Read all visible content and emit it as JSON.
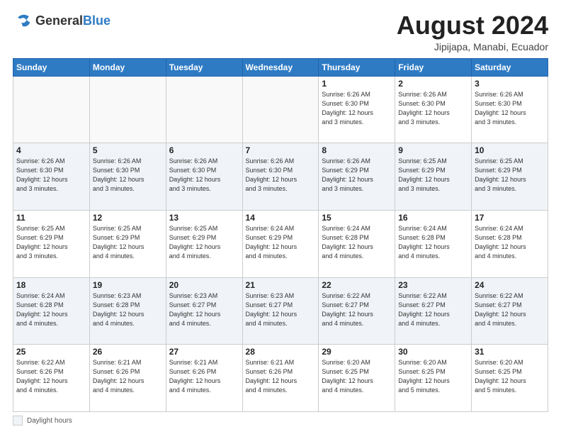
{
  "header": {
    "logo_general": "General",
    "logo_blue": "Blue",
    "month_year": "August 2024",
    "location": "Jipijapa, Manabi, Ecuador"
  },
  "days_of_week": [
    "Sunday",
    "Monday",
    "Tuesday",
    "Wednesday",
    "Thursday",
    "Friday",
    "Saturday"
  ],
  "weeks": [
    [
      {
        "day": "",
        "info": ""
      },
      {
        "day": "",
        "info": ""
      },
      {
        "day": "",
        "info": ""
      },
      {
        "day": "",
        "info": ""
      },
      {
        "day": "1",
        "info": "Sunrise: 6:26 AM\nSunset: 6:30 PM\nDaylight: 12 hours\nand 3 minutes."
      },
      {
        "day": "2",
        "info": "Sunrise: 6:26 AM\nSunset: 6:30 PM\nDaylight: 12 hours\nand 3 minutes."
      },
      {
        "day": "3",
        "info": "Sunrise: 6:26 AM\nSunset: 6:30 PM\nDaylight: 12 hours\nand 3 minutes."
      }
    ],
    [
      {
        "day": "4",
        "info": "Sunrise: 6:26 AM\nSunset: 6:30 PM\nDaylight: 12 hours\nand 3 minutes."
      },
      {
        "day": "5",
        "info": "Sunrise: 6:26 AM\nSunset: 6:30 PM\nDaylight: 12 hours\nand 3 minutes."
      },
      {
        "day": "6",
        "info": "Sunrise: 6:26 AM\nSunset: 6:30 PM\nDaylight: 12 hours\nand 3 minutes."
      },
      {
        "day": "7",
        "info": "Sunrise: 6:26 AM\nSunset: 6:30 PM\nDaylight: 12 hours\nand 3 minutes."
      },
      {
        "day": "8",
        "info": "Sunrise: 6:26 AM\nSunset: 6:29 PM\nDaylight: 12 hours\nand 3 minutes."
      },
      {
        "day": "9",
        "info": "Sunrise: 6:25 AM\nSunset: 6:29 PM\nDaylight: 12 hours\nand 3 minutes."
      },
      {
        "day": "10",
        "info": "Sunrise: 6:25 AM\nSunset: 6:29 PM\nDaylight: 12 hours\nand 3 minutes."
      }
    ],
    [
      {
        "day": "11",
        "info": "Sunrise: 6:25 AM\nSunset: 6:29 PM\nDaylight: 12 hours\nand 3 minutes."
      },
      {
        "day": "12",
        "info": "Sunrise: 6:25 AM\nSunset: 6:29 PM\nDaylight: 12 hours\nand 4 minutes."
      },
      {
        "day": "13",
        "info": "Sunrise: 6:25 AM\nSunset: 6:29 PM\nDaylight: 12 hours\nand 4 minutes."
      },
      {
        "day": "14",
        "info": "Sunrise: 6:24 AM\nSunset: 6:29 PM\nDaylight: 12 hours\nand 4 minutes."
      },
      {
        "day": "15",
        "info": "Sunrise: 6:24 AM\nSunset: 6:28 PM\nDaylight: 12 hours\nand 4 minutes."
      },
      {
        "day": "16",
        "info": "Sunrise: 6:24 AM\nSunset: 6:28 PM\nDaylight: 12 hours\nand 4 minutes."
      },
      {
        "day": "17",
        "info": "Sunrise: 6:24 AM\nSunset: 6:28 PM\nDaylight: 12 hours\nand 4 minutes."
      }
    ],
    [
      {
        "day": "18",
        "info": "Sunrise: 6:24 AM\nSunset: 6:28 PM\nDaylight: 12 hours\nand 4 minutes."
      },
      {
        "day": "19",
        "info": "Sunrise: 6:23 AM\nSunset: 6:28 PM\nDaylight: 12 hours\nand 4 minutes."
      },
      {
        "day": "20",
        "info": "Sunrise: 6:23 AM\nSunset: 6:27 PM\nDaylight: 12 hours\nand 4 minutes."
      },
      {
        "day": "21",
        "info": "Sunrise: 6:23 AM\nSunset: 6:27 PM\nDaylight: 12 hours\nand 4 minutes."
      },
      {
        "day": "22",
        "info": "Sunrise: 6:22 AM\nSunset: 6:27 PM\nDaylight: 12 hours\nand 4 minutes."
      },
      {
        "day": "23",
        "info": "Sunrise: 6:22 AM\nSunset: 6:27 PM\nDaylight: 12 hours\nand 4 minutes."
      },
      {
        "day": "24",
        "info": "Sunrise: 6:22 AM\nSunset: 6:27 PM\nDaylight: 12 hours\nand 4 minutes."
      }
    ],
    [
      {
        "day": "25",
        "info": "Sunrise: 6:22 AM\nSunset: 6:26 PM\nDaylight: 12 hours\nand 4 minutes."
      },
      {
        "day": "26",
        "info": "Sunrise: 6:21 AM\nSunset: 6:26 PM\nDaylight: 12 hours\nand 4 minutes."
      },
      {
        "day": "27",
        "info": "Sunrise: 6:21 AM\nSunset: 6:26 PM\nDaylight: 12 hours\nand 4 minutes."
      },
      {
        "day": "28",
        "info": "Sunrise: 6:21 AM\nSunset: 6:26 PM\nDaylight: 12 hours\nand 4 minutes."
      },
      {
        "day": "29",
        "info": "Sunrise: 6:20 AM\nSunset: 6:25 PM\nDaylight: 12 hours\nand 4 minutes."
      },
      {
        "day": "30",
        "info": "Sunrise: 6:20 AM\nSunset: 6:25 PM\nDaylight: 12 hours\nand 5 minutes."
      },
      {
        "day": "31",
        "info": "Sunrise: 6:20 AM\nSunset: 6:25 PM\nDaylight: 12 hours\nand 5 minutes."
      }
    ]
  ],
  "footer": {
    "label": "Daylight hours"
  }
}
